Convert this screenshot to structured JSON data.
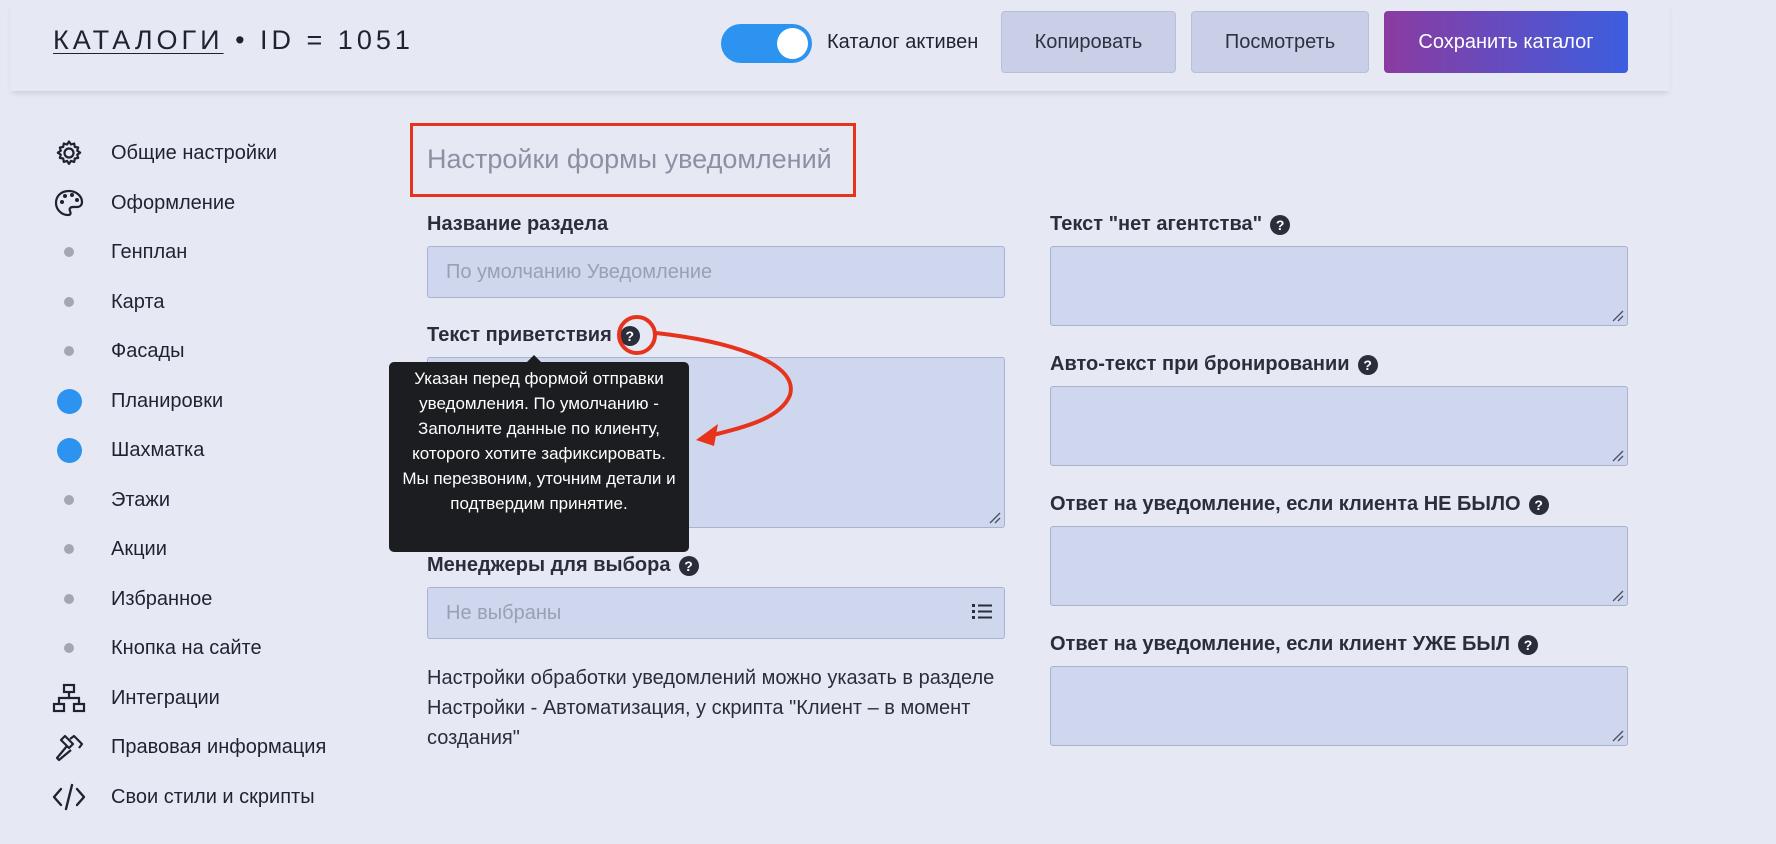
{
  "header": {
    "title_link": "КАТАЛОГИ",
    "title_rest": " • ID = 1051",
    "toggle_label": "Каталог активен",
    "toggle_on": true,
    "copy_label": "Копировать",
    "view_label": "Посмотреть",
    "save_label": "Сохранить каталог"
  },
  "sidebar": {
    "items": [
      {
        "label": "Общие настройки",
        "icon": "gear-icon"
      },
      {
        "label": "Оформление",
        "icon": "palette-icon"
      },
      {
        "label": "Генплан",
        "icon": "dot-icon"
      },
      {
        "label": "Карта",
        "icon": "dot-icon"
      },
      {
        "label": "Фасады",
        "icon": "dot-icon"
      },
      {
        "label": "Планировки",
        "icon": "dot-active-icon"
      },
      {
        "label": "Шахматка",
        "icon": "dot-active-icon"
      },
      {
        "label": "Этажи",
        "icon": "dot-icon"
      },
      {
        "label": "Акции",
        "icon": "dot-icon"
      },
      {
        "label": "Избранное",
        "icon": "dot-icon"
      },
      {
        "label": "Кнопка на сайте",
        "icon": "dot-icon"
      },
      {
        "label": "Интеграции",
        "icon": "sitemap-icon"
      },
      {
        "label": "Правовая информация",
        "icon": "gavel-icon"
      },
      {
        "label": "Свои стили и скрипты",
        "icon": "code-icon"
      }
    ]
  },
  "main": {
    "section_title": "Настройки формы уведомлений",
    "section_name_label": "Название раздела",
    "section_name_placeholder": "По умолчанию Уведомление",
    "greeting_label": "Текст приветствия",
    "managers_label": "Менеджеры для выбора",
    "managers_placeholder": "Не выбраны",
    "info_text": "Настройки обработки уведомлений можно указать в разделе Настройки - Автоматизация, у скрипта \"Клиент – в момент создания\"",
    "no_agency_label": "Текст \"нет агентства\"",
    "autotext_label": "Авто-текст при бронировании",
    "reply_new_label": "Ответ на уведомление, если клиента НЕ БЫЛО",
    "reply_existing_label": "Ответ на уведомление, если клиент УЖЕ БЫЛ",
    "help_glyph": "?"
  },
  "tooltip": {
    "text": "Указан перед формой отправки уведомления. По умолчанию - Заполните данные по клиенту, которого хотите зафиксировать. Мы перезвоним, уточним детали и подтвердим принятие."
  },
  "colors": {
    "accent": "#2d93f0",
    "annotation": "#e8331c",
    "save_gradient_start": "#8b3ba0",
    "save_gradient_end": "#3c5ee0"
  }
}
